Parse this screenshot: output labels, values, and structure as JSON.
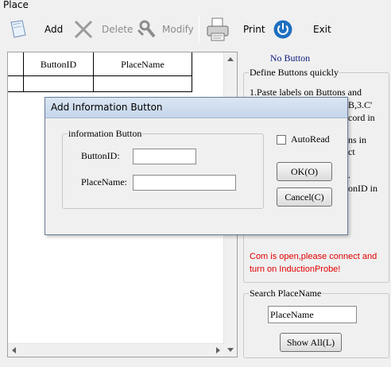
{
  "window": {
    "title": "Place"
  },
  "toolbar": {
    "add_label": "Add",
    "delete_label": "Delete",
    "modify_label": "Modify",
    "print_label": "Print",
    "exit_label": "Exit"
  },
  "grid": {
    "columns": [
      "ButtonID",
      "PlaceName"
    ]
  },
  "right_panel": {
    "status_title": "No Button",
    "define_legend": "Define Buttons quickly",
    "instructions": [
      "1.Paste labels on Buttons and",
      "B,3.C'",
      "cord in",
      "ns in",
      "ct",
      ".",
      "onID in"
    ],
    "com_message": [
      "Com is open,please connect and",
      "turn on InductionProbe!"
    ],
    "search_legend": "Search PlaceName",
    "search_value": "PlaceName",
    "show_all_label": "Show All(L)"
  },
  "dialog": {
    "title": "Add Information Button",
    "group_legend": "information Button",
    "button_id_label": "ButtonID:",
    "place_name_label": "PlaceName:",
    "button_id_value": "",
    "place_name_value": "",
    "autoread_label": "AutoRead",
    "autoread_checked": false,
    "ok_label": "OK(O)",
    "cancel_label": "Cancel(C)"
  },
  "colors": {
    "status_title": "#0a1a78",
    "com_message": "#e00000",
    "exit_icon": "#1f6fc0"
  }
}
